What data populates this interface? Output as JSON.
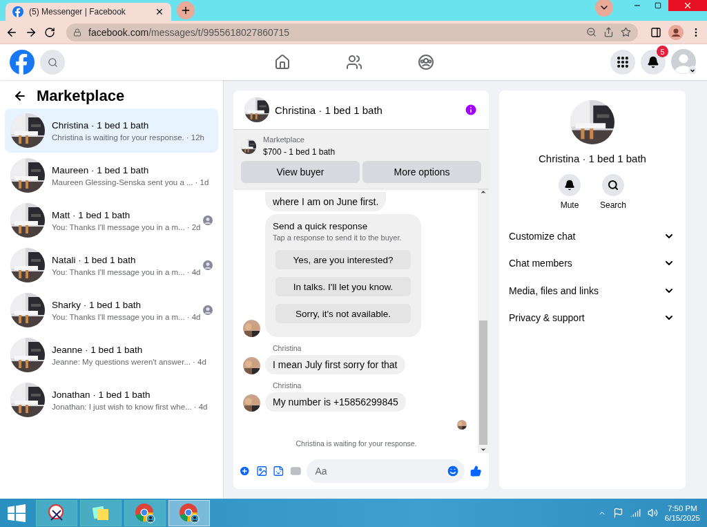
{
  "browser": {
    "tab_title": "(5) Messenger | Facebook",
    "url_host": "facebook.com",
    "url_path": "/messages/t/9955618027860715"
  },
  "header": {
    "notification_count": "5"
  },
  "sidebar": {
    "title": "Marketplace",
    "conversations": [
      {
        "name": "Christina · 1 bed 1 bath",
        "preview": "Christina is waiting for your response.",
        "time": "· 12h",
        "selected": true,
        "seen": false
      },
      {
        "name": "Maureen · 1 bed 1 bath",
        "preview": "Maureen Glessing-Senska sent you a ...",
        "time": "· 1d",
        "selected": false,
        "seen": false
      },
      {
        "name": "Matt · 1 bed 1 bath",
        "preview": "You: Thanks I'll message you in a m...",
        "time": "· 2d",
        "selected": false,
        "seen": true
      },
      {
        "name": "Natali · 1 bed 1 bath",
        "preview": "You: Thanks I'll message you in a m...",
        "time": "· 4d",
        "selected": false,
        "seen": true
      },
      {
        "name": "Sharky · 1 bed 1 bath",
        "preview": "You: Thanks I'll message you in a m...",
        "time": "· 4d",
        "selected": false,
        "seen": true
      },
      {
        "name": "Jeanne · 1 bed 1 bath",
        "preview": "Jeanne: My questions weren't answer...",
        "time": "· 4d",
        "selected": false,
        "seen": false
      },
      {
        "name": "Jonathan · 1 bed 1 bath",
        "preview": "Jonathan: I just wish to know first whe...",
        "time": "· 4d",
        "selected": false,
        "seen": false
      }
    ]
  },
  "chat": {
    "title": "Christina · 1 bed 1 bath",
    "banner": {
      "label": "Marketplace",
      "listing": "$700 - 1 bed 1 bath",
      "buttons": [
        "View buyer",
        "More options"
      ]
    },
    "messages": [
      {
        "kind": "bubble",
        "text": "where I am on June first.",
        "avatar": false
      },
      {
        "kind": "quick_response",
        "title": "Send a quick response",
        "subtitle": "Tap a response to send it to the buyer.",
        "options": [
          "Yes, are you interested?",
          "In talks. I'll let you know.",
          "Sorry, it's not available."
        ],
        "avatar": true
      },
      {
        "kind": "bubble",
        "sender": "Christina",
        "text": "I mean July first sorry for that",
        "avatar": true
      },
      {
        "kind": "bubble",
        "sender": "Christina",
        "text": "My number is +15856299845",
        "avatar": true
      }
    ],
    "status": "Christina is waiting for your response.",
    "composer_placeholder": "Aa"
  },
  "details": {
    "name": "Christina · 1 bed 1 bath",
    "actions": [
      {
        "kind": "mute",
        "label": "Mute"
      },
      {
        "kind": "search",
        "label": "Search"
      }
    ],
    "sections": [
      {
        "label": "Customize chat",
        "expanded": false
      },
      {
        "label": "Chat members",
        "expanded": false
      },
      {
        "label": "Media, files and links",
        "expanded": false
      },
      {
        "label": "Privacy & support",
        "expanded": false
      }
    ]
  },
  "taskbar": {
    "apps": [
      {
        "kind": "snip",
        "selected": false
      },
      {
        "kind": "notes",
        "selected": false
      },
      {
        "kind": "chrome",
        "selected": false
      },
      {
        "kind": "chrome",
        "selected": true
      }
    ],
    "time": "7:50 PM",
    "date": "6/15/2025"
  }
}
